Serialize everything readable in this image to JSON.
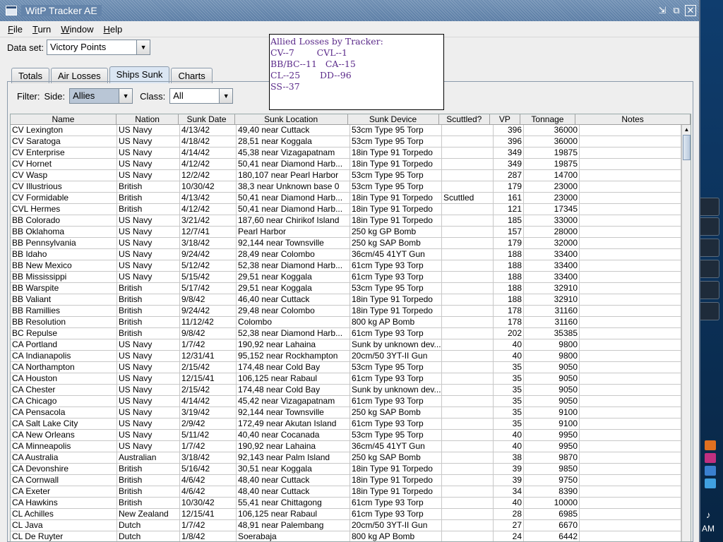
{
  "window": {
    "title": "WitP Tracker AE"
  },
  "menu": [
    {
      "mnemonic": "F",
      "rest": "ile"
    },
    {
      "mnemonic": "T",
      "rest": "urn"
    },
    {
      "mnemonic": "W",
      "rest": "indow"
    },
    {
      "mnemonic": "H",
      "rest": "elp"
    }
  ],
  "dataset": {
    "label": "Data set:",
    "value": "Victory Points"
  },
  "tabs": [
    "Totals",
    "Air Losses",
    "Ships Sunk",
    "Charts"
  ],
  "active_tab": "Ships Sunk",
  "filter": {
    "label": "Filter:",
    "side_label": "Side:",
    "side_value": "Allies",
    "class_label": "Class:",
    "class_value": "All"
  },
  "popup": {
    "lines": [
      "Allied Losses by Tracker:",
      "CV--7        CVL--1",
      "BB/BC--11   CA--15",
      "CL--25       DD--96",
      "SS--37"
    ]
  },
  "table": {
    "columns": [
      "Name",
      "Nation",
      "Sunk Date",
      "Sunk Location",
      "Sunk Device",
      "Scuttled?",
      "VP",
      "Tonnage",
      "Notes"
    ],
    "rows": [
      [
        "CV Lexington",
        "US Navy",
        "4/13/42",
        "49,40 near Cuttack",
        "53cm Type 95 Torp",
        "",
        "396",
        "36000",
        ""
      ],
      [
        "CV Saratoga",
        "US Navy",
        "4/18/42",
        "28,51 near Koggala",
        "53cm Type 95 Torp",
        "",
        "396",
        "36000",
        ""
      ],
      [
        "CV Enterprise",
        "US Navy",
        "4/14/42",
        "45,38 near Vizagapatnam",
        "18in Type 91 Torpedo",
        "",
        "349",
        "19875",
        ""
      ],
      [
        "CV Hornet",
        "US Navy",
        "4/12/42",
        "50,41 near Diamond Harb...",
        "18in Type 91 Torpedo",
        "",
        "349",
        "19875",
        ""
      ],
      [
        "CV Wasp",
        "US Navy",
        "12/2/42",
        "180,107 near Pearl Harbor",
        "53cm Type 95 Torp",
        "",
        "287",
        "14700",
        ""
      ],
      [
        "CV Illustrious",
        "British",
        "10/30/42",
        "38,3 near Unknown base 0",
        "53cm Type 95 Torp",
        "",
        "179",
        "23000",
        ""
      ],
      [
        "CV Formidable",
        "British",
        "4/13/42",
        "50,41 near Diamond Harb...",
        "18in Type 91 Torpedo",
        "Scuttled",
        "161",
        "23000",
        ""
      ],
      [
        "CVL Hermes",
        "British",
        "4/12/42",
        "50,41 near Diamond Harb...",
        "18in Type 91 Torpedo",
        "",
        "121",
        "17345",
        ""
      ],
      [
        "BB Colorado",
        "US Navy",
        "3/21/42",
        "187,60 near Chirikof Island",
        "18in Type 91 Torpedo",
        "",
        "185",
        "33000",
        ""
      ],
      [
        "BB Oklahoma",
        "US Navy",
        "12/7/41",
        "Pearl Harbor",
        "250 kg GP Bomb",
        "",
        "157",
        "28000",
        ""
      ],
      [
        "BB Pennsylvania",
        "US Navy",
        "3/18/42",
        "92,144 near Townsville",
        "250 kg SAP Bomb",
        "",
        "179",
        "32000",
        ""
      ],
      [
        "BB Idaho",
        "US Navy",
        "9/24/42",
        "28,49 near Colombo",
        "36cm/45 41YT Gun",
        "",
        "188",
        "33400",
        ""
      ],
      [
        "BB New Mexico",
        "US Navy",
        "5/12/42",
        "52,38 near Diamond Harb...",
        "61cm Type 93 Torp",
        "",
        "188",
        "33400",
        ""
      ],
      [
        "BB Mississippi",
        "US Navy",
        "5/15/42",
        "29,51 near Koggala",
        "61cm Type 93 Torp",
        "",
        "188",
        "33400",
        ""
      ],
      [
        "BB Warspite",
        "British",
        "5/17/42",
        "29,51 near Koggala",
        "53cm Type 95 Torp",
        "",
        "188",
        "32910",
        ""
      ],
      [
        "BB Valiant",
        "British",
        "9/8/42",
        "46,40 near Cuttack",
        "18in Type 91 Torpedo",
        "",
        "188",
        "32910",
        ""
      ],
      [
        "BB Ramillies",
        "British",
        "9/24/42",
        "29,48 near Colombo",
        "18in Type 91 Torpedo",
        "",
        "178",
        "31160",
        ""
      ],
      [
        "BB Resolution",
        "British",
        "11/12/42",
        "Colombo",
        "800 kg AP Bomb",
        "",
        "178",
        "31160",
        ""
      ],
      [
        "BC Repulse",
        "British",
        "9/8/42",
        "52,38 near Diamond Harb...",
        "61cm Type 93 Torp",
        "",
        "202",
        "35385",
        ""
      ],
      [
        "CA Portland",
        "US Navy",
        "1/7/42",
        "190,92 near Lahaina",
        "Sunk by unknown dev...",
        "",
        "40",
        "9800",
        ""
      ],
      [
        "CA Indianapolis",
        "US Navy",
        "12/31/41",
        "95,152 near Rockhampton",
        "20cm/50 3YT-II Gun",
        "",
        "40",
        "9800",
        ""
      ],
      [
        "CA Northampton",
        "US Navy",
        "2/15/42",
        "174,48 near Cold Bay",
        "53cm Type 95 Torp",
        "",
        "35",
        "9050",
        ""
      ],
      [
        "CA Houston",
        "US Navy",
        "12/15/41",
        "106,125 near Rabaul",
        "61cm Type 93 Torp",
        "",
        "35",
        "9050",
        ""
      ],
      [
        "CA Chester",
        "US Navy",
        "2/15/42",
        "174,48 near Cold Bay",
        "Sunk by unknown dev...",
        "",
        "35",
        "9050",
        ""
      ],
      [
        "CA Chicago",
        "US Navy",
        "4/14/42",
        "45,42 near Vizagapatnam",
        "61cm Type 93 Torp",
        "",
        "35",
        "9050",
        ""
      ],
      [
        "CA Pensacola",
        "US Navy",
        "3/19/42",
        "92,144 near Townsville",
        "250 kg SAP Bomb",
        "",
        "35",
        "9100",
        ""
      ],
      [
        "CA Salt Lake City",
        "US Navy",
        "2/9/42",
        "172,49 near Akutan Island",
        "61cm Type 93 Torp",
        "",
        "35",
        "9100",
        ""
      ],
      [
        "CA New Orleans",
        "US Navy",
        "5/11/42",
        "40,40 near Cocanada",
        "53cm Type 95 Torp",
        "",
        "40",
        "9950",
        ""
      ],
      [
        "CA Minneapolis",
        "US Navy",
        "1/7/42",
        "190,92 near Lahaina",
        "36cm/45 41YT Gun",
        "",
        "40",
        "9950",
        ""
      ],
      [
        "CA Australia",
        "Australian",
        "3/18/42",
        "92,143 near Palm Island",
        "250 kg SAP Bomb",
        "",
        "38",
        "9870",
        ""
      ],
      [
        "CA Devonshire",
        "British",
        "5/16/42",
        "30,51 near Koggala",
        "18in Type 91 Torpedo",
        "",
        "39",
        "9850",
        ""
      ],
      [
        "CA Cornwall",
        "British",
        "4/6/42",
        "48,40 near Cuttack",
        "18in Type 91 Torpedo",
        "",
        "39",
        "9750",
        ""
      ],
      [
        "CA Exeter",
        "British",
        "4/6/42",
        "48,40 near Cuttack",
        "18in Type 91 Torpedo",
        "",
        "34",
        "8390",
        ""
      ],
      [
        "CA Hawkins",
        "British",
        "10/30/42",
        "55,41 near Chittagong",
        "61cm Type 93 Torp",
        "",
        "40",
        "10000",
        ""
      ],
      [
        "CL Achilles",
        "New Zealand",
        "12/15/41",
        "106,125 near Rabaul",
        "61cm Type 93 Torp",
        "",
        "28",
        "6985",
        ""
      ],
      [
        "CL Java",
        "Dutch",
        "1/7/42",
        "48,91 near Palembang",
        "20cm/50 3YT-II Gun",
        "",
        "27",
        "6670",
        ""
      ],
      [
        "CL De Ruyter",
        "Dutch",
        "1/8/42",
        "Soerabaja",
        "800 kg AP Bomb",
        "",
        "24",
        "6442",
        ""
      ]
    ]
  },
  "desktop": {
    "clock": "AM"
  }
}
